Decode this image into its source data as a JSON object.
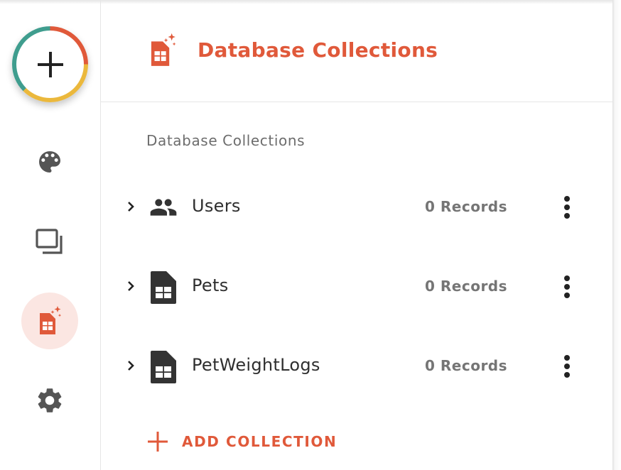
{
  "colors": {
    "accent": "#e0593a",
    "accent_yellow": "#ebb83c",
    "accent_teal": "#3f9d8e",
    "active_bg": "#fbe6e2",
    "icon_dark": "#333333",
    "icon_gray": "#555555"
  },
  "rail": {
    "fab_icon": "plus-icon",
    "items": [
      {
        "icon": "palette-icon",
        "active": false
      },
      {
        "icon": "layers-icon",
        "active": false
      },
      {
        "icon": "database-sheet-icon",
        "active": true
      },
      {
        "icon": "gear-icon",
        "active": false
      }
    ]
  },
  "header": {
    "icon": "database-sheet-icon",
    "title": "Database Collections"
  },
  "main": {
    "section_label": "Database Collections",
    "collections": [
      {
        "name": "Users",
        "records": "0 Records",
        "icon": "people-icon"
      },
      {
        "name": "Pets",
        "records": "0 Records",
        "icon": "sheet-icon"
      },
      {
        "name": "PetWeightLogs",
        "records": "0 Records",
        "icon": "sheet-icon"
      }
    ],
    "add_button_label": "ADD COLLECTION",
    "add_button_icon": "plus-icon"
  }
}
